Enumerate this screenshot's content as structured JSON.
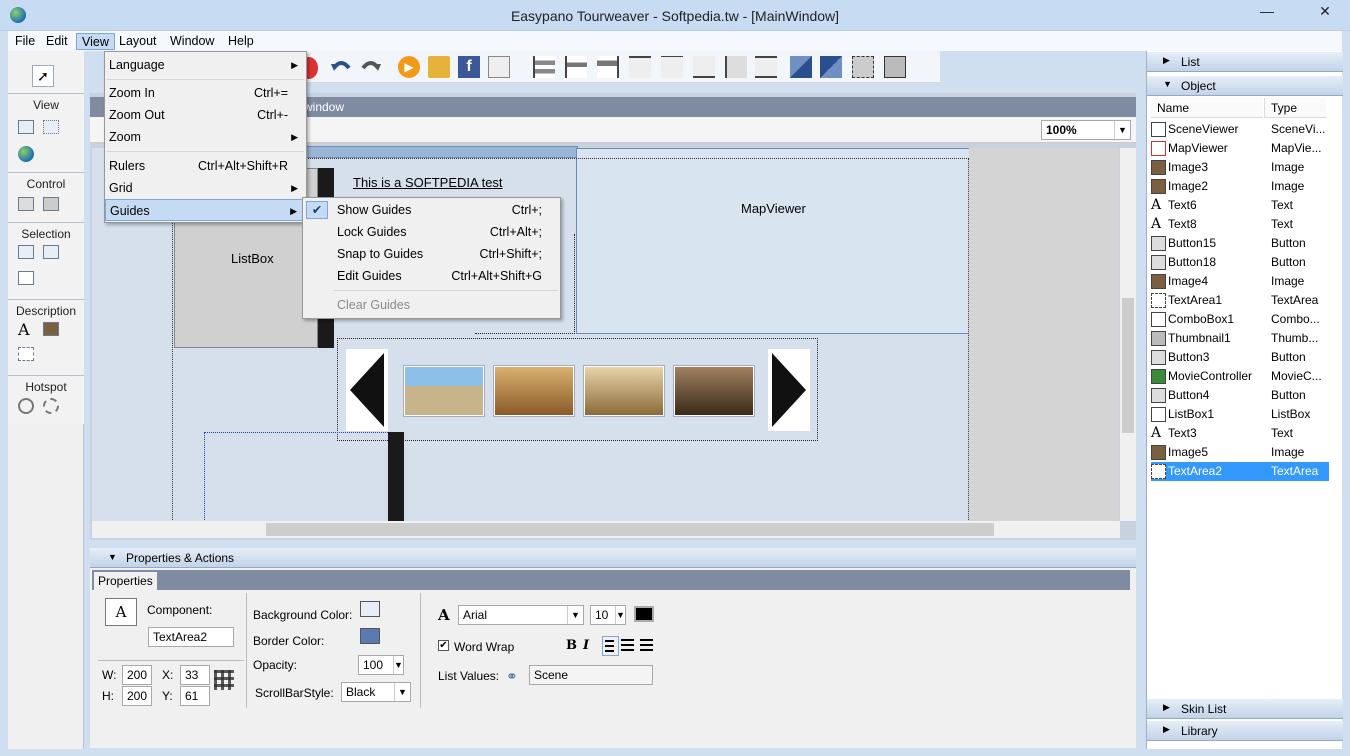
{
  "window": {
    "title": "Easypano Tourweaver - Softpedia.tw - [MainWindow]",
    "minimize": "—",
    "close": "✕"
  },
  "menubar": {
    "items": [
      "File",
      "Edit",
      "View",
      "Layout",
      "Window",
      "Help"
    ]
  },
  "view_menu": {
    "items": [
      {
        "label": "Language",
        "shortcut": "",
        "submenu": true
      },
      {
        "label": "Zoom In",
        "shortcut": "Ctrl+=",
        "submenu": false
      },
      {
        "label": "Zoom Out",
        "shortcut": "Ctrl+-",
        "submenu": false
      },
      {
        "label": "Zoom",
        "shortcut": "",
        "submenu": true
      },
      {
        "label": "Rulers",
        "shortcut": "Ctrl+Alt+Shift+R",
        "submenu": false
      },
      {
        "label": "Grid",
        "shortcut": "",
        "submenu": true
      },
      {
        "label": "Guides",
        "shortcut": "",
        "submenu": true
      }
    ],
    "submenu_arrow": "▶"
  },
  "guides_menu": {
    "items": [
      {
        "label": "Show Guides",
        "shortcut": "Ctrl+;",
        "checked": true,
        "enabled": true
      },
      {
        "label": "Lock Guides",
        "shortcut": "Ctrl+Alt+;",
        "checked": false,
        "enabled": true
      },
      {
        "label": "Snap to Guides",
        "shortcut": "Ctrl+Shift+;",
        "checked": false,
        "enabled": true
      },
      {
        "label": "Edit Guides",
        "shortcut": "Ctrl+Alt+Shift+G",
        "checked": false,
        "enabled": true
      },
      {
        "label": "Clear Guides",
        "shortcut": "",
        "checked": false,
        "enabled": false
      }
    ],
    "check_glyph": "✔"
  },
  "left_panel": {
    "sections": [
      "View",
      "Control",
      "Selection",
      "Description",
      "Hotspot"
    ]
  },
  "document": {
    "tab_title": "window",
    "zoom": "100%"
  },
  "canvas": {
    "test_text": "This is a SOFTPEDIA test",
    "listbox_label": "ListBox",
    "mapviewer_label": "MapViewer"
  },
  "right_panel": {
    "list_header": "List",
    "object_header": "Object",
    "col_name": "Name",
    "col_type": "Type",
    "objects": [
      {
        "name": "SceneViewer",
        "type": "SceneVi...",
        "icon": "sceneviewer-icon"
      },
      {
        "name": "MapViewer",
        "type": "MapVie...",
        "icon": "mapviewer-icon"
      },
      {
        "name": "Image3",
        "type": "Image",
        "icon": "image-icon"
      },
      {
        "name": "Image2",
        "type": "Image",
        "icon": "image-icon"
      },
      {
        "name": "Text6",
        "type": "Text",
        "icon": "text-icon"
      },
      {
        "name": "Text8",
        "type": "Text",
        "icon": "text-icon"
      },
      {
        "name": "Button15",
        "type": "Button",
        "icon": "button-icon"
      },
      {
        "name": "Button18",
        "type": "Button",
        "icon": "button-icon"
      },
      {
        "name": "Image4",
        "type": "Image",
        "icon": "image-icon"
      },
      {
        "name": "TextArea1",
        "type": "TextArea",
        "icon": "textarea-icon"
      },
      {
        "name": "ComboBox1",
        "type": "Combo...",
        "icon": "combobox-icon"
      },
      {
        "name": "Thumbnail1",
        "type": "Thumb...",
        "icon": "thumbnail-icon"
      },
      {
        "name": "Button3",
        "type": "Button",
        "icon": "button-icon"
      },
      {
        "name": "MovieController",
        "type": "MovieC...",
        "icon": "moviecontroller-icon"
      },
      {
        "name": "Button4",
        "type": "Button",
        "icon": "button-icon"
      },
      {
        "name": "ListBox1",
        "type": "ListBox",
        "icon": "listbox-icon"
      },
      {
        "name": "Text3",
        "type": "Text",
        "icon": "text-icon"
      },
      {
        "name": "Image5",
        "type": "Image",
        "icon": "image-icon"
      },
      {
        "name": "TextArea2",
        "type": "TextArea",
        "icon": "textarea-icon",
        "selected": true
      }
    ],
    "skin_list_header": "Skin List",
    "library_header": "Library"
  },
  "properties": {
    "header": "Properties & Actions",
    "tab": "Properties",
    "component_label": "Component:",
    "component_value": "TextArea2",
    "w_label": "W:",
    "w_value": "200",
    "h_label": "H:",
    "h_value": "200",
    "x_label": "X:",
    "x_value": "33",
    "y_label": "Y:",
    "y_value": "61",
    "bg_color_label": "Background Color:",
    "border_color_label": "Border Color:",
    "opacity_label": "Opacity:",
    "opacity_value": "100",
    "scrollbar_style_label": "ScrollBarStyle:",
    "scrollbar_style_value": "Black",
    "font_value": "Arial",
    "font_size_value": "10",
    "word_wrap_label": "Word Wrap",
    "word_wrap_checked": true,
    "list_values_label": "List Values:",
    "list_values_value": "Scene",
    "bold": "B",
    "italic": "I"
  },
  "colors": {
    "accent": "#3399ff",
    "menu_highlight": "#c5dbf3",
    "background_color_swatch": "#e6eef8",
    "border_color_swatch": "#5a7ab0",
    "text_color_swatch": "#000000"
  }
}
